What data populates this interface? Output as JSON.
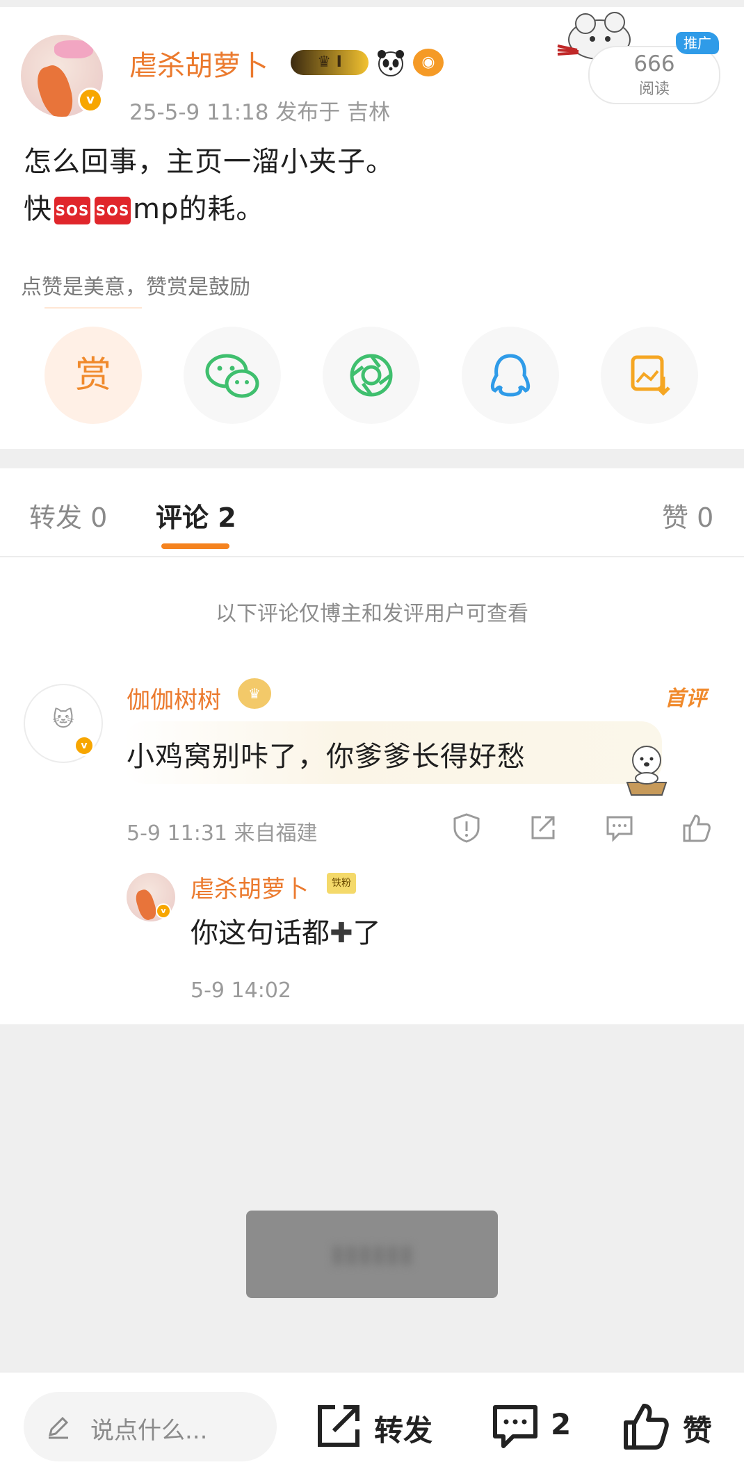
{
  "post": {
    "author": "虐杀胡萝卜",
    "verified_mark": "v",
    "level_badge": "I",
    "meta": "25-5-9 11:18  发布于 吉林",
    "read_count": "666",
    "read_label": "阅读",
    "promo_tag": "推广",
    "text_line1": "怎么回事，主页一溜小夹子。",
    "text_line2_before": "快",
    "sos_label": "SOS",
    "text_line2_after": "mp的耗。",
    "reward_hint": "点赞是美意，赞赏是鼓励",
    "reward_button": "赏",
    "share_icons": [
      "wechat-icon",
      "moments-icon",
      "qq-icon",
      "save-image-icon"
    ]
  },
  "tabs": {
    "repost": "转发 0",
    "comment": "评论 2",
    "like": "赞 0"
  },
  "notice": "以下评论仅博主和发评用户可查看",
  "comment": {
    "author": "伽伽树树",
    "first_tag": "首评",
    "text": "小鸡窝别咔了，你爹爹长得好愁",
    "meta": "5-9 11:31  来自福建"
  },
  "reply": {
    "author": "虐杀胡萝卜",
    "badge": "铁粉",
    "text_before": "你这句话都",
    "text_after": "了",
    "meta": "5-9 14:02"
  },
  "bottom_bar": {
    "say_placeholder": "说点什么...",
    "repost": "转发",
    "comment_count": "2",
    "like": "赞"
  },
  "colors": {
    "accent": "#f5831f",
    "name": "#eb7a2e",
    "promo": "#2f9be8",
    "sos": "#e0262b"
  }
}
